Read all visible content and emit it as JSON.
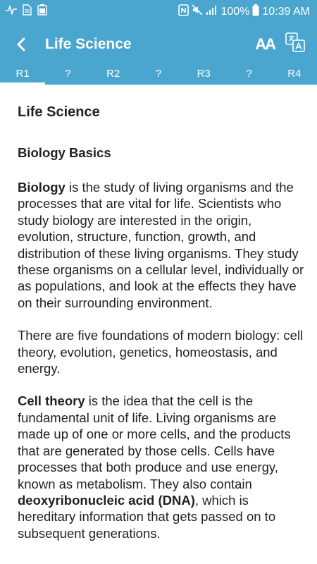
{
  "status_bar": {
    "battery_percent": "100%",
    "time": "10:39 AM",
    "left_icons": [
      "pulse-icon",
      "document-icon",
      "battery-saver-icon"
    ],
    "right_icons": [
      "nfc-icon",
      "mute-icon",
      "signal-icon"
    ]
  },
  "app_bar": {
    "title": "Life Science",
    "font_size_label": "AA"
  },
  "tabs": [
    "R1",
    "?",
    "R2",
    "?",
    "R3",
    "?",
    "R4"
  ],
  "content": {
    "title": "Life Science",
    "section_title": "Biology Basics",
    "p1_bold": "Biology",
    "p1_text": " is the study of living organisms and the processes that are vital for life. Scientists who study biology are interested in the origin, evolution, structure, function, growth, and distribution of these living organisms. They study these organisms on a cellular level, individually or as populations, and look at the effects they have on their surrounding environment.",
    "p2_text": "There are five foundations of modern biology: cell theory, evolution, genetics, homeostasis, and energy.",
    "p3_bold": "Cell theory",
    "p3_text_a": " is the idea that the cell is the fundamental unit of life. Living organisms are made up of one or more cells, and the products that are generated by those cells. Cells have processes that both produce and use energy, known as metabolism. They also contain ",
    "p3_bold_2": "deoxyribonucleic acid (DNA)",
    "p3_text_b": ", which is hereditary information that gets passed on to subsequent generations."
  },
  "colors": {
    "primary": "#4aa6cf",
    "text": "#222222"
  }
}
